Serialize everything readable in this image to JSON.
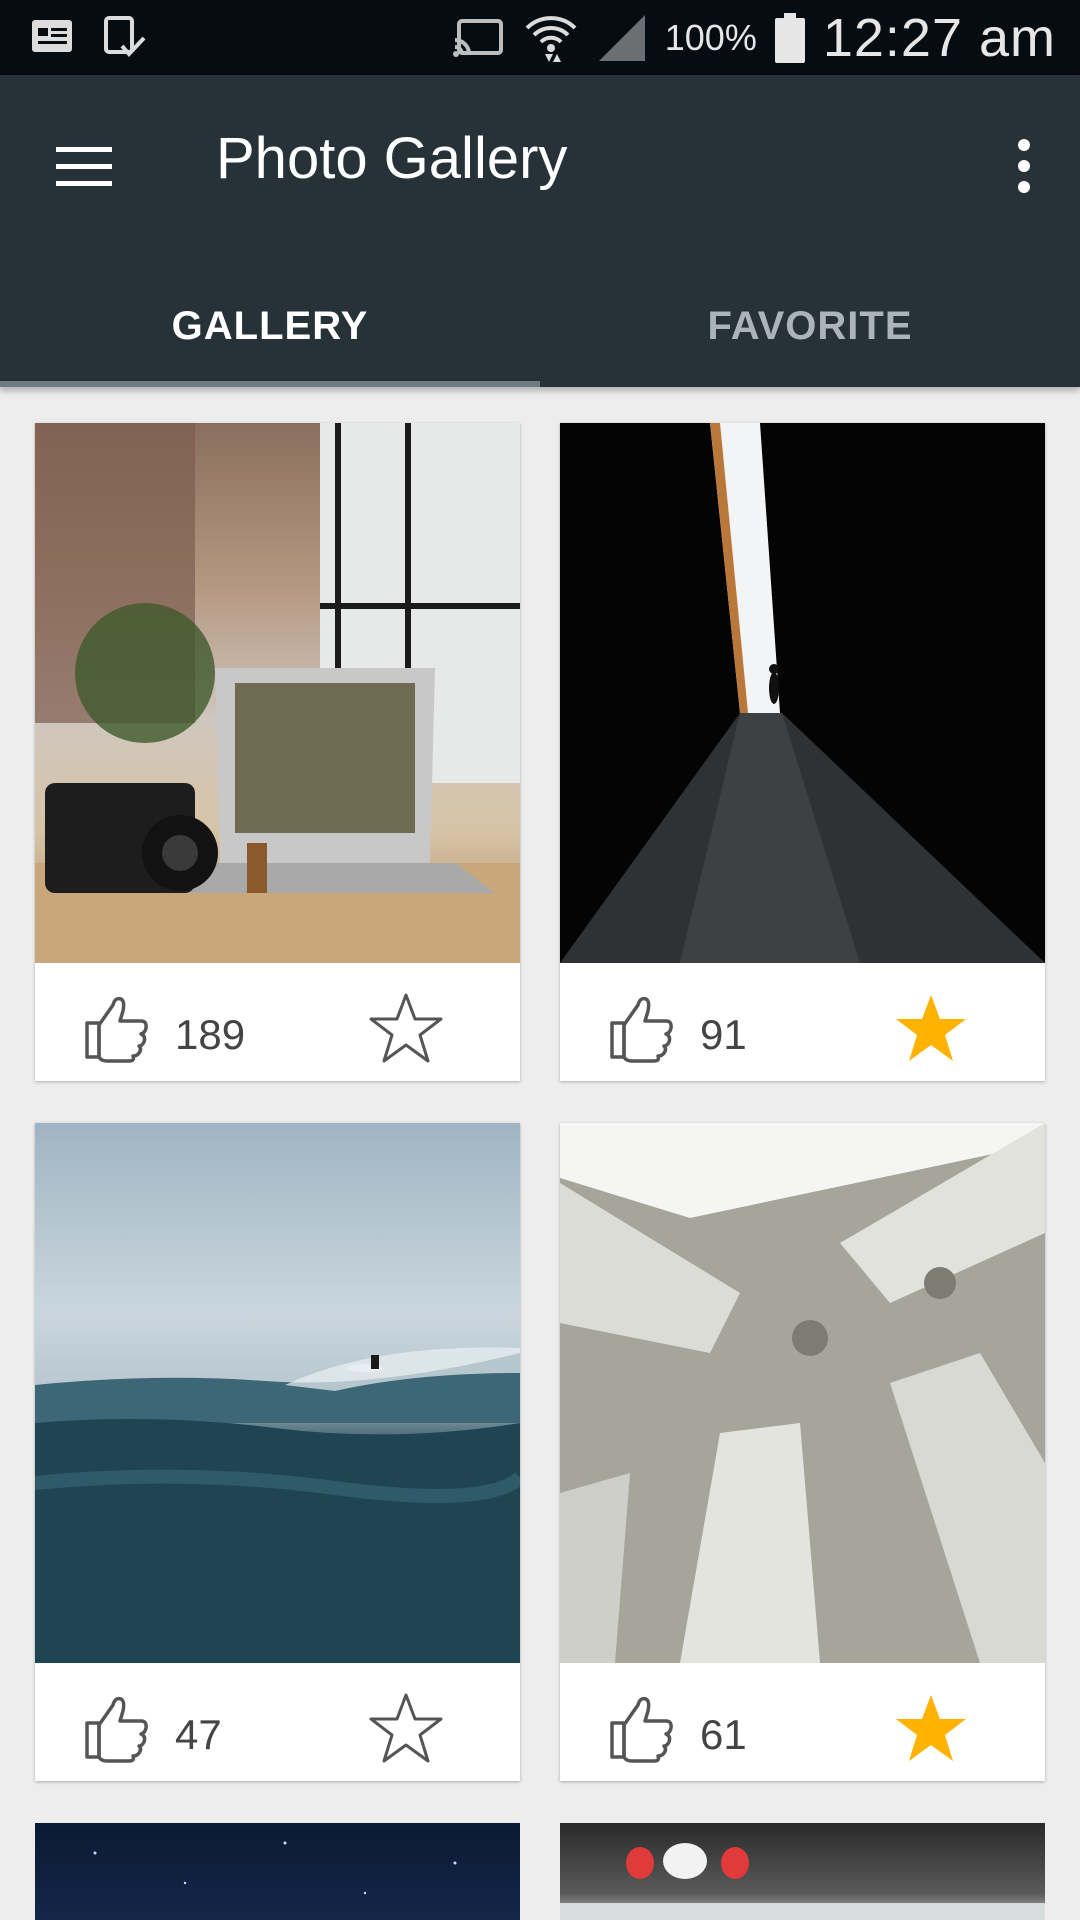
{
  "status_bar": {
    "battery_percent": "100%",
    "time": "12:27 am"
  },
  "app_bar": {
    "title": "Photo Gallery"
  },
  "tabs": [
    {
      "label": "GALLERY",
      "active": true
    },
    {
      "label": "FAVORITE",
      "active": false
    }
  ],
  "photos": [
    {
      "likes": "189",
      "favorite": false
    },
    {
      "likes": "91",
      "favorite": true
    },
    {
      "likes": "47",
      "favorite": false
    },
    {
      "likes": "61",
      "favorite": true
    }
  ],
  "colors": {
    "app_bar": "#263238",
    "status_bar": "#050d13",
    "star_active": "#FFB300",
    "background": "#ededed"
  }
}
